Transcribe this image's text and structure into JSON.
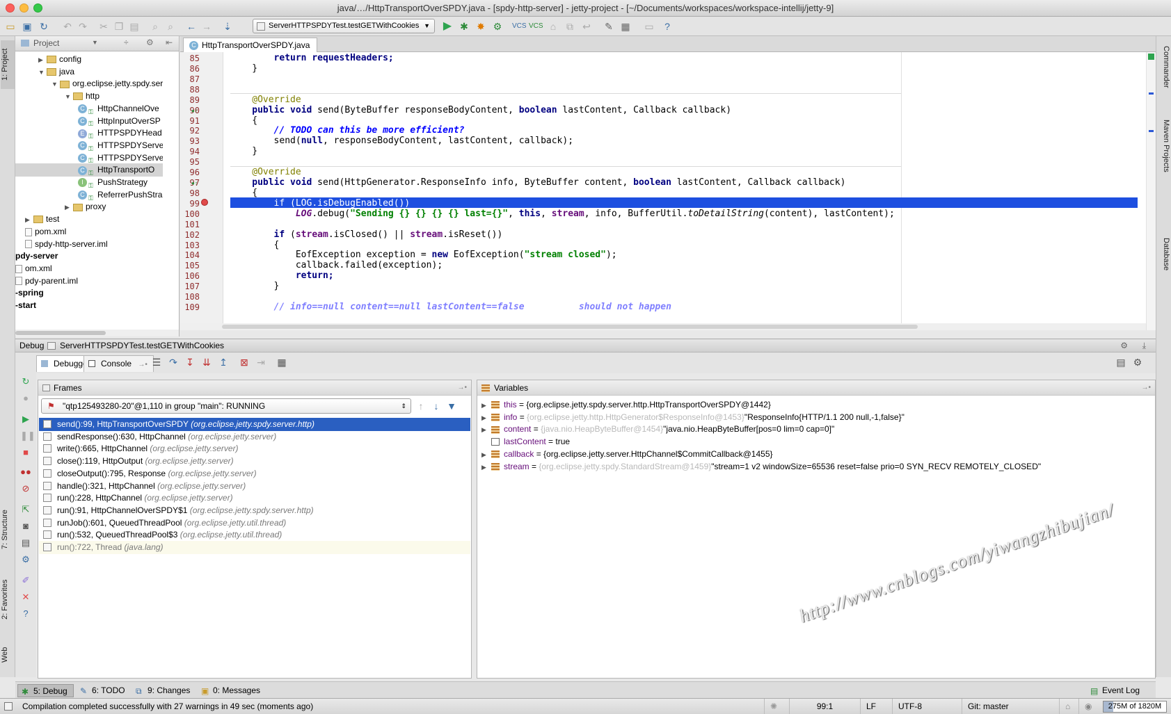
{
  "window": {
    "title": "java/…/HttpTransportOverSPDY.java - [spdy-http-server] - jetty-project - [~/Documents/workspaces/workspace-intellij/jetty-9]"
  },
  "toolbar": {
    "run_config": "ServerHTTPSPDYTest.testGETWithCookies"
  },
  "left_strip": {
    "project_tab": "1: Project",
    "structure_tab": "7: Structure",
    "favorites_tab": "2: Favorites",
    "web_tab": "Web"
  },
  "right_strip": {
    "commander_tab": "Commander",
    "maven_tab": "Maven Projects",
    "database_tab": "Database"
  },
  "project": {
    "view_label": "Project",
    "tree": [
      {
        "label": "config",
        "kind": "folder",
        "depth": 1,
        "expanded": false
      },
      {
        "label": "java",
        "kind": "folder",
        "depth": 1,
        "expanded": true
      },
      {
        "label": "org.eclipse.jetty.spdy.serv",
        "kind": "folder",
        "depth": 2,
        "expanded": true
      },
      {
        "label": "http",
        "kind": "folder",
        "depth": 3,
        "expanded": true
      },
      {
        "label": "HttpChannelOve",
        "kind": "class",
        "badge": "C",
        "depth": 4
      },
      {
        "label": "HttpInputOverSP",
        "kind": "class",
        "badge": "C",
        "depth": 4
      },
      {
        "label": "HTTPSPDYHead",
        "kind": "enum",
        "badge": "E",
        "depth": 4
      },
      {
        "label": "HTTPSPDYServe",
        "kind": "class",
        "badge": "C",
        "depth": 4
      },
      {
        "label": "HTTPSPDYServe",
        "kind": "class",
        "badge": "C",
        "depth": 4
      },
      {
        "label": "HttpTransportO",
        "kind": "class",
        "badge": "C",
        "depth": 4,
        "selected": true
      },
      {
        "label": "PushStrategy",
        "kind": "interface",
        "badge": "I",
        "depth": 4
      },
      {
        "label": "ReferrerPushStra",
        "kind": "class",
        "badge": "C",
        "depth": 4
      },
      {
        "label": "proxy",
        "kind": "folder",
        "depth": 3,
        "expanded": false
      },
      {
        "label": "test",
        "kind": "folder",
        "depth": 0,
        "expanded": false
      },
      {
        "label": "pom.xml",
        "kind": "file",
        "depth": 0
      },
      {
        "label": "spdy-http-server.iml",
        "kind": "file",
        "depth": 0
      },
      {
        "label": "pdy-server",
        "kind": "module",
        "depth": -1
      },
      {
        "label": "om.xml",
        "kind": "file",
        "depth": -1
      },
      {
        "label": "pdy-parent.iml",
        "kind": "file",
        "depth": -1
      },
      {
        "label": "-spring",
        "kind": "module",
        "depth": -1
      },
      {
        "label": "-start",
        "kind": "module",
        "depth": -1
      }
    ]
  },
  "editor": {
    "tab_label": "HttpTransportOverSPDY.java",
    "line_numbers": [
      "85",
      "86",
      "87",
      "88",
      "89",
      "90",
      "91",
      "92",
      "93",
      "94",
      "95",
      "96",
      "97",
      "98",
      "99",
      "100",
      "101",
      "102",
      "103",
      "104",
      "105",
      "106",
      "107",
      "108",
      "109"
    ],
    "code": {
      "l85": "return requestHeaders;",
      "l86": "}",
      "l89": "@Override",
      "l90_kw": "public void",
      "l90_rest": " send(ByteBuffer responseBodyContent, ",
      "l90_kw2": "boolean",
      "l90_rest2": " lastContent, Callback callback)",
      "l91": "{",
      "l92": "// TODO can this be more efficient?",
      "l93_a": "send(",
      "l93_kw": "null",
      "l93_b": ", responseBodyContent, lastContent, callback);",
      "l94": "}",
      "l96": "@Override",
      "l97_kw": "public void",
      "l97_rest": " send(HttpGenerator.ResponseInfo info, ByteBuffer content, ",
      "l97_kw2": "boolean",
      "l97_rest2": " lastContent, Callback callback)",
      "l98": "{",
      "l99": "if (LOG.isDebugEnabled())",
      "l100_log": "LOG",
      "l100_a": ".debug(",
      "l100_str": "\"Sending {} {} {} {} last={}\"",
      "l100_b": ", ",
      "l100_this": "this",
      "l100_c": ", ",
      "l100_stream": "stream",
      "l100_d": ", info, BufferUtil.",
      "l100_m": "toDetailString",
      "l100_e": "(content), lastContent);",
      "l102_kw": "if",
      "l102_a": " (",
      "l102_s1": "stream",
      "l102_b": ".isClosed() || ",
      "l102_s2": "stream",
      "l102_c": ".isReset())",
      "l103": "{",
      "l104_a": "EofException exception = ",
      "l104_kw": "new",
      "l104_b": " EofException(",
      "l104_str": "\"stream closed\"",
      "l104_c": ");",
      "l105": "callback.failed(exception);",
      "l106": "return;",
      "l107": "}",
      "l109": "// info==null content==null lastContent==false          should not happen"
    }
  },
  "debug": {
    "header_label": "Debug",
    "config_name": "ServerHTTPSPDYTest.testGETWithCookies",
    "tabs": [
      "Debugger",
      "Console"
    ],
    "frames_title": "Frames",
    "thread": "\"qtp125493280-20\"@1,110 in group \"main\": RUNNING",
    "frames": [
      {
        "method": "send():99, HttpTransportOverSPDY",
        "pkg": "(org.eclipse.jetty.spdy.server.http)",
        "selected": true
      },
      {
        "method": "sendResponse():630, HttpChannel",
        "pkg": "(org.eclipse.jetty.server)"
      },
      {
        "method": "write():665, HttpChannel",
        "pkg": "(org.eclipse.jetty.server)"
      },
      {
        "method": "close():119, HttpOutput",
        "pkg": "(org.eclipse.jetty.server)"
      },
      {
        "method": "closeOutput():795, Response",
        "pkg": "(org.eclipse.jetty.server)"
      },
      {
        "method": "handle():321, HttpChannel",
        "pkg": "(org.eclipse.jetty.server)"
      },
      {
        "method": "run():228, HttpChannel",
        "pkg": "(org.eclipse.jetty.server)"
      },
      {
        "method": "run():91, HttpChannelOverSPDY$1",
        "pkg": "(org.eclipse.jetty.spdy.server.http)"
      },
      {
        "method": "runJob():601, QueuedThreadPool",
        "pkg": "(org.eclipse.jetty.util.thread)"
      },
      {
        "method": "run():532, QueuedThreadPool$3",
        "pkg": "(org.eclipse.jetty.util.thread)"
      },
      {
        "method": "run():722, Thread",
        "pkg": "(java.lang)",
        "library": true
      }
    ],
    "variables_title": "Variables",
    "variables": [
      {
        "name": "this",
        "id": "",
        "value": "{org.eclipse.jetty.spdy.server.http.HttpTransportOverSPDY@1442}",
        "expandable": true
      },
      {
        "name": "info",
        "id": "{org.eclipse.jetty.http.HttpGenerator$ResponseInfo@1453}",
        "value": "\"ResponseInfo{HTTP/1.1 200 null,-1,false}\"",
        "expandable": true
      },
      {
        "name": "content",
        "id": "{java.nio.HeapByteBuffer@1454}",
        "value": "\"java.nio.HeapByteBuffer[pos=0 lim=0 cap=0]\"",
        "expandable": true
      },
      {
        "name": "lastContent",
        "id": "",
        "value": "true",
        "expandable": false
      },
      {
        "name": "callback",
        "id": "",
        "value": "{org.eclipse.jetty.server.HttpChannel$CommitCallback@1455}",
        "expandable": true
      },
      {
        "name": "stream",
        "id": "{org.eclipse.jetty.spdy.StandardStream@1459}",
        "value": "\"stream=1 v2 windowSize=65536 reset=false prio=0 SYN_RECV REMOTELY_CLOSED\"",
        "expandable": true
      }
    ]
  },
  "bottom_tabs": {
    "debug": "5: Debug",
    "todo": "6: TODO",
    "changes": "9: Changes",
    "messages": "0: Messages",
    "event_log": "Event Log"
  },
  "status": {
    "message": "Compilation completed successfully with 27 warnings in 49 sec (moments ago)",
    "position": "99:1",
    "line_sep": "LF",
    "encoding": "UTF-8",
    "vcs": "Git: master",
    "memory": "275M of 1820M",
    "memory_fraction": 0.151
  },
  "watermark": "http://www.cnblogs.com/yiwangzhibujian/",
  "colors": {
    "selection": "#2a5fc1",
    "execution_line": "#1d4fe0",
    "keyword": "#000080",
    "string": "#008000",
    "field": "#660e7a",
    "comment": "#0000ff"
  }
}
